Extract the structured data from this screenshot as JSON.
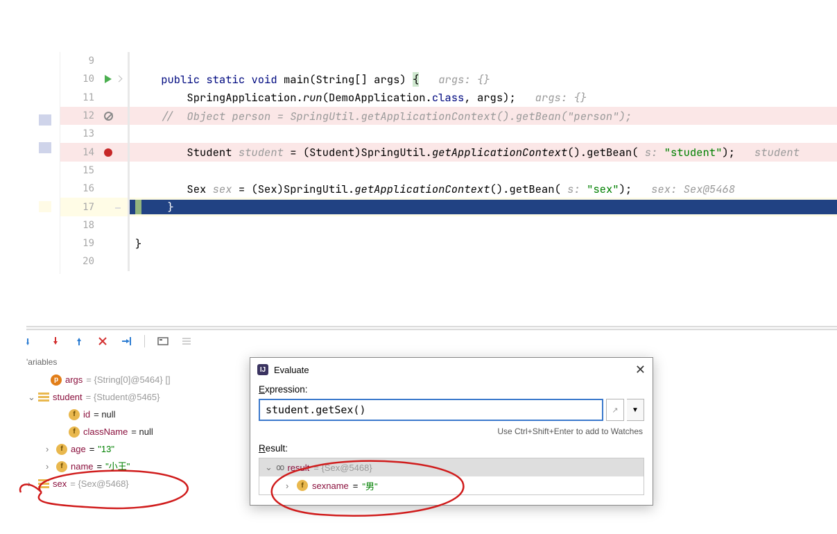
{
  "editor": {
    "lines": {
      "l9": {
        "n": "9",
        "code": ""
      },
      "l10": {
        "n": "10",
        "pre": "    ",
        "kw1": "public",
        "sp1": " ",
        "kw2": "static",
        "sp2": " ",
        "kw3": "void",
        "sp3": " ",
        "id": "main",
        "sig": "(String[] args) ",
        "br": "{",
        "sp4": "   ",
        "hint": "args: {}"
      },
      "l11": {
        "n": "11",
        "pre": "        SpringApplication.",
        "meth": "run",
        "mid": "(DemoApplication.",
        "kw": "class",
        "post": ", args);",
        "sp": "   ",
        "hint": "args: {}"
      },
      "l12": {
        "n": "12",
        "pre": "    ",
        "cmnt": "//  Object person = SpringUtil.getApplicationContext().getBean(\"person\");"
      },
      "l13": {
        "n": "13",
        "code": ""
      },
      "l14": {
        "n": "14",
        "pre": "        Student ",
        "hint1": "student",
        "mid": " = (Student)SpringUtil.",
        "meth": "getApplicationContext",
        "post1": "().getBean( ",
        "hint2": "s:",
        "sp1": " ",
        "str": "\"student\"",
        "post2": ");",
        "sp2": "   ",
        "hint3": "student"
      },
      "l15": {
        "n": "15",
        "code": ""
      },
      "l16": {
        "n": "16",
        "pre": "        Sex ",
        "hint1": "sex",
        "mid": " = (Sex)SpringUtil.",
        "meth": "getApplicationContext",
        "post1": "().getBean( ",
        "hint2": "s:",
        "sp1": " ",
        "str": "\"sex\"",
        "post2": ");",
        "sp2": "   ",
        "hint3": "sex: Sex@5468"
      },
      "l17": {
        "n": "17",
        "code": "    }"
      },
      "l18": {
        "n": "18",
        "code": ""
      },
      "l19": {
        "n": "19",
        "code": "}"
      },
      "l20": {
        "n": "20",
        "code": ""
      }
    }
  },
  "variables": {
    "title": "'ariables",
    "args_name": "args",
    "args_val": " = {String[0]@5464} []",
    "student_name": "student",
    "student_val": " = {Student@5465}",
    "id_name": "id",
    "id_val": " = null",
    "class_name": "className",
    "class_val": " = null",
    "age_name": "age",
    "age_eq": " = ",
    "age_str": "\"13\"",
    "name_name": "name",
    "name_eq": " = ",
    "name_str": "\"小王\"",
    "sex_name": "sex",
    "sex_val": " = {Sex@5468}"
  },
  "dlg": {
    "title": "Evaluate",
    "expr_label": "Expression:",
    "expr_value": "student.getSex()",
    "hint": "Use Ctrl+Shift+Enter to add to Watches",
    "result_label": "Result:",
    "result_name": "result",
    "result_val": " = {Sex@5468}",
    "sexn_name": "sexname",
    "sexn_eq": " = ",
    "sexn_val": "\"男\""
  }
}
